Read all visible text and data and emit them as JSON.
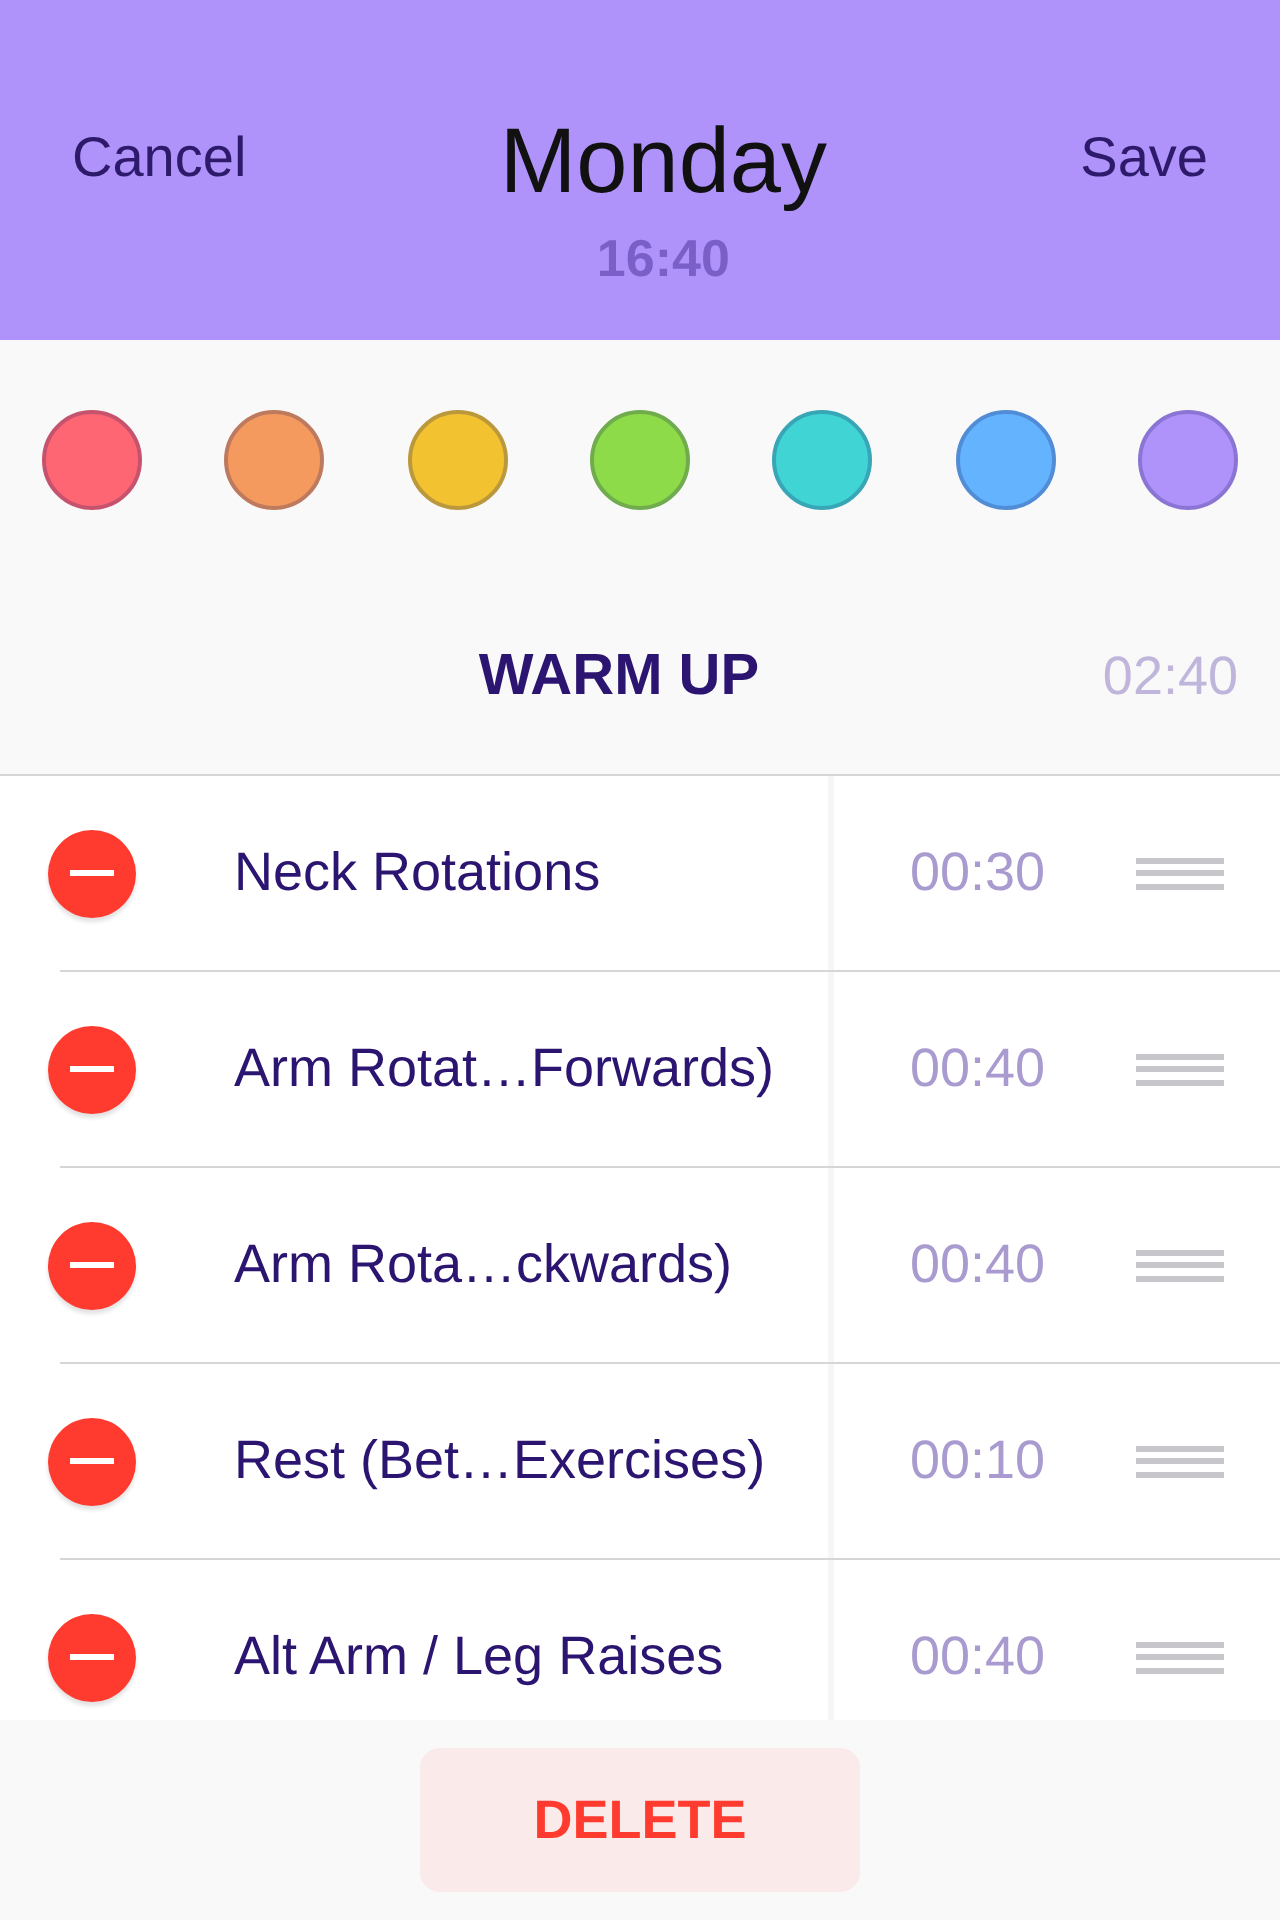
{
  "header": {
    "cancel": "Cancel",
    "title": "Monday",
    "time": "16:40",
    "save": "Save"
  },
  "colors": [
    {
      "color": "#ff6673"
    },
    {
      "color": "#f59a5f"
    },
    {
      "color": "#f2c230"
    },
    {
      "color": "#8ddb48"
    },
    {
      "color": "#40d4d4"
    },
    {
      "color": "#63b3ff"
    },
    {
      "color": "#af93fa"
    }
  ],
  "section": {
    "title": "WARM UP",
    "duration": "02:40"
  },
  "exercises": [
    {
      "name": "Neck Rotations",
      "duration": "00:30"
    },
    {
      "name": "Arm Rotat…Forwards)",
      "duration": "00:40"
    },
    {
      "name": "Arm Rota…ckwards)",
      "duration": "00:40"
    },
    {
      "name": "Rest (Bet…Exercises)",
      "duration": "00:10"
    },
    {
      "name": "Alt Arm / Leg Raises",
      "duration": "00:40"
    }
  ],
  "delete_button": "DELETE"
}
